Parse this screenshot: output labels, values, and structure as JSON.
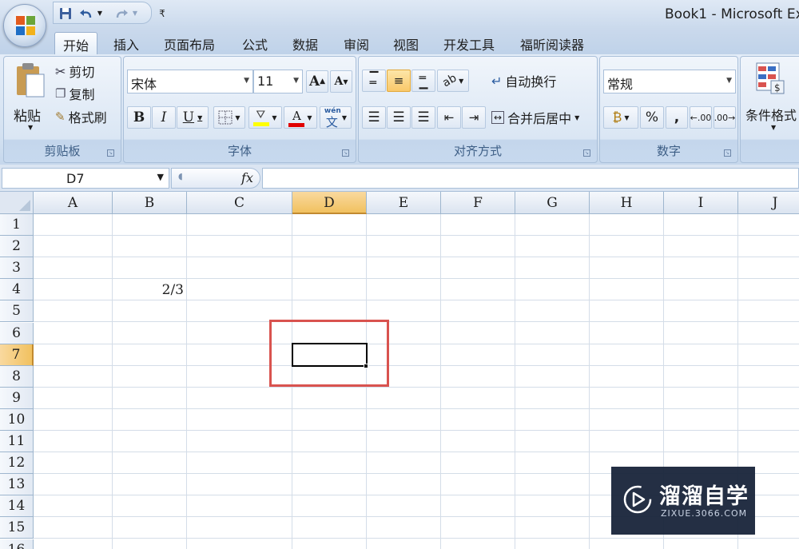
{
  "window": {
    "title": "Book1 - Microsoft Ex"
  },
  "quick_access": {
    "save_icon": "save-icon",
    "undo_icon": "undo-icon",
    "redo_icon": "redo-icon",
    "customize": "₹"
  },
  "tabs": [
    "开始",
    "插入",
    "页面布局",
    "公式",
    "数据",
    "审阅",
    "视图",
    "开发工具",
    "福昕阅读器"
  ],
  "active_tab": "开始",
  "clipboard": {
    "paste": "粘贴",
    "cut": "剪切",
    "copy": "复制",
    "format_painter": "格式刷",
    "label": "剪贴板"
  },
  "font": {
    "name": "宋体",
    "size": "11",
    "grow": "A",
    "shrink": "A",
    "bold": "B",
    "italic": "I",
    "underline": "U",
    "font_color": "A",
    "phonetic": "wén",
    "phonetic_char": "文",
    "label": "字体"
  },
  "alignment": {
    "wrap_text": "自动换行",
    "merge_center": "合并后居中",
    "label": "对齐方式"
  },
  "number": {
    "format": "常规",
    "percent": "%",
    "comma": ",",
    "inc_decimal": ".00",
    "dec_decimal": ".00",
    "label": "数字"
  },
  "styles": {
    "conditional_format": "条件格式"
  },
  "formula_bar": {
    "name_box": "D7",
    "fx": "fx",
    "formula": ""
  },
  "sheet": {
    "columns": [
      "A",
      "B",
      "C",
      "D",
      "E",
      "F",
      "G",
      "H",
      "I",
      "J"
    ],
    "rows": [
      "1",
      "2",
      "3",
      "4",
      "5",
      "6",
      "7",
      "8",
      "9",
      "10",
      "11",
      "12",
      "13",
      "14",
      "15",
      "16"
    ],
    "selected_column": "D",
    "selected_row": "7",
    "cells": {
      "B4": "2/3"
    }
  },
  "watermark": {
    "title": "溜溜自学",
    "subtitle": "ZIXUE.3066.COM"
  },
  "colors": {
    "selection_header": "#f1c15f",
    "highlight_box": "#d9534f",
    "ribbon_label": "#3e5f86"
  }
}
